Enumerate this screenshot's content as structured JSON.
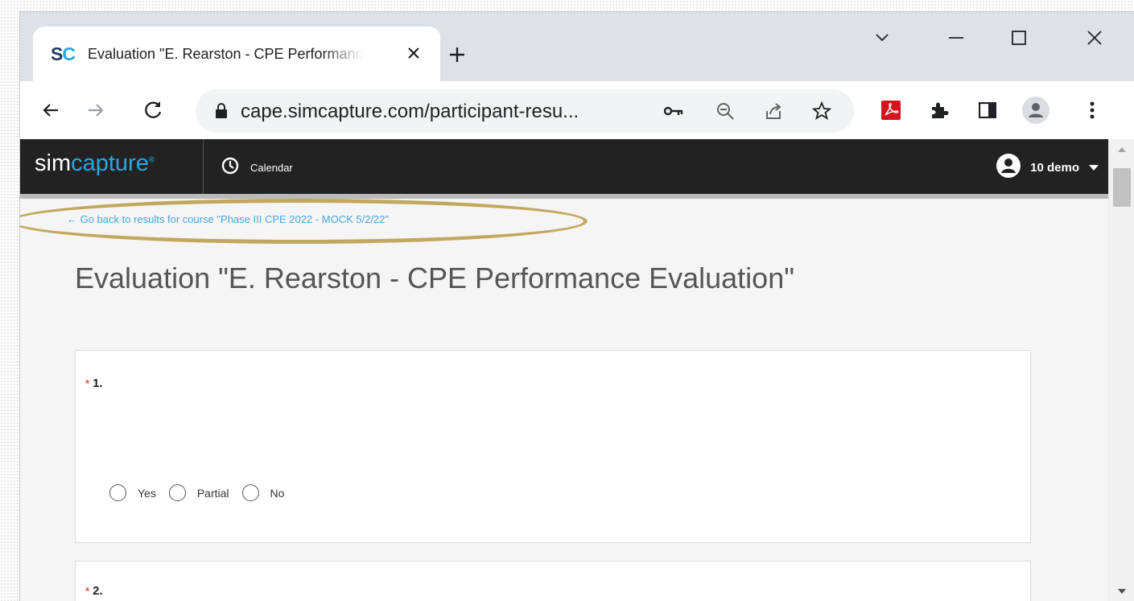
{
  "browser": {
    "tab": {
      "favicon_text_left": "S",
      "favicon_text_right": "C",
      "title": "Evaluation \"E. Rearston - CPE Performance Evaluation\""
    },
    "new_tab_glyph": "+",
    "url": "cape.simcapture.com/participant-resu...",
    "icons": [
      "back-icon",
      "forward-icon",
      "reload-icon",
      "lock-icon",
      "key-icon",
      "zoom-out-icon",
      "share-icon",
      "star-icon",
      "pdf-extension-icon",
      "extensions-icon",
      "side-panel-icon",
      "profile-icon",
      "more-menu-icon",
      "tab-search-icon",
      "minimize-icon",
      "maximize-icon",
      "close-icon"
    ]
  },
  "app": {
    "brand_prefix": "sim",
    "brand_suffix": "capture",
    "brand_mark": "®",
    "nav_calendar": "Calendar",
    "user_name": "10 demo"
  },
  "page": {
    "back_link": "← Go back to results for course \"Phase III CPE 2022 - MOCK 5/2/22\"",
    "title": "Evaluation \"E. Rearston - CPE Performance Evaluation\"",
    "questions": [
      {
        "required_mark": "*",
        "number": "1.",
        "options": [
          "Yes",
          "Partial",
          "No"
        ]
      },
      {
        "required_mark": "*",
        "number": "2."
      }
    ]
  },
  "colors": {
    "accent": "#29a8e0",
    "appbar": "#222222",
    "link": "#4aa6d9",
    "highlight_oval": "#c2a85e",
    "required": "#d9534f"
  }
}
